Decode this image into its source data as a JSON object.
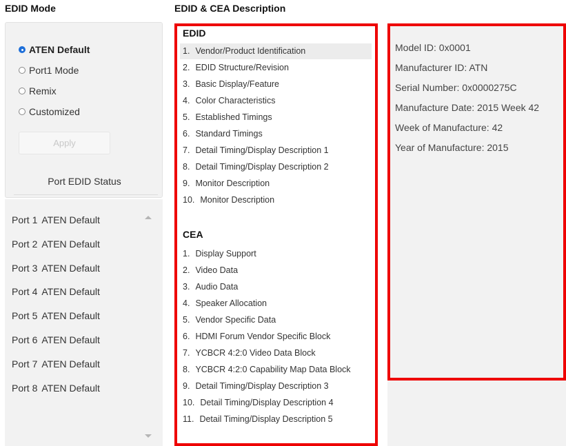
{
  "left_title": "EDID Mode",
  "mid_title": "EDID & CEA Description",
  "modes": [
    {
      "label": "ATEN Default",
      "checked": true
    },
    {
      "label": "Port1 Mode",
      "checked": false
    },
    {
      "label": "Remix",
      "checked": false
    },
    {
      "label": "Customized",
      "checked": false
    }
  ],
  "apply_label": "Apply",
  "port_status_title": "Port EDID Status",
  "ports": [
    {
      "port": "Port 1",
      "status": "ATEN Default"
    },
    {
      "port": "Port 2",
      "status": "ATEN Default"
    },
    {
      "port": "Port 3",
      "status": "ATEN Default"
    },
    {
      "port": "Port 4",
      "status": "ATEN Default"
    },
    {
      "port": "Port 5",
      "status": "ATEN Default"
    },
    {
      "port": "Port 6",
      "status": "ATEN Default"
    },
    {
      "port": "Port 7",
      "status": "ATEN Default"
    },
    {
      "port": "Port 8",
      "status": "ATEN Default"
    }
  ],
  "edid": {
    "title": "EDID",
    "items": [
      {
        "num": "1.",
        "text": "Vendor/Product Identification",
        "selected": true
      },
      {
        "num": "2.",
        "text": "EDID Structure/Revision"
      },
      {
        "num": "3.",
        "text": "Basic Display/Feature"
      },
      {
        "num": "4.",
        "text": "Color Characteristics"
      },
      {
        "num": "5.",
        "text": "Established Timings"
      },
      {
        "num": "6.",
        "text": "Standard Timings"
      },
      {
        "num": "7.",
        "text": "Detail Timing/Display Description 1"
      },
      {
        "num": "8.",
        "text": "Detail Timing/Display Description 2"
      },
      {
        "num": "9.",
        "text": "Monitor Description"
      },
      {
        "num": "10.",
        "text": "Monitor Description"
      }
    ]
  },
  "cea": {
    "title": "CEA",
    "items": [
      {
        "num": "1.",
        "text": "Display Support"
      },
      {
        "num": "2.",
        "text": "Video Data"
      },
      {
        "num": "3.",
        "text": "Audio Data"
      },
      {
        "num": "4.",
        "text": "Speaker Allocation"
      },
      {
        "num": "5.",
        "text": "Vendor Specific Data"
      },
      {
        "num": "6.",
        "text": "HDMI Forum Vendor Specific Block"
      },
      {
        "num": "7.",
        "text": "YCBCR 4:2:0 Video Data Block"
      },
      {
        "num": "8.",
        "text": "YCBCR 4:2:0 Capability Map Data Block"
      },
      {
        "num": "9.",
        "text": "Detail Timing/Display Description 3"
      },
      {
        "num": "10.",
        "text": "Detail Timing/Display Description 4"
      },
      {
        "num": "11.",
        "text": "Detail Timing/Display Description 5"
      }
    ]
  },
  "details": [
    "Model ID: 0x0001",
    "Manufacturer ID: ATN",
    "Serial Number: 0x0000275C",
    "Manufacture Date: 2015 Week 42",
    "Week of Manufacture: 42",
    "Year of Manufacture: 2015"
  ],
  "colors": {
    "highlight_border": "#ee0000",
    "radio_accent": "#1e6fd9",
    "panel_bg": "#f2f2f2"
  }
}
